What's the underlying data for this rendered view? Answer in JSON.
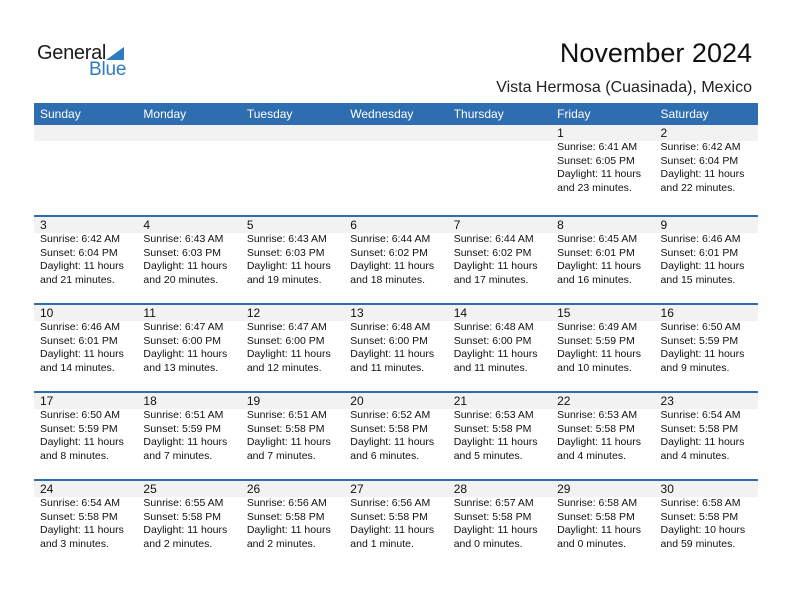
{
  "brand": {
    "name_part1": "General",
    "name_part2": "Blue",
    "accent": "#2e6db0"
  },
  "header": {
    "title": "November 2024",
    "location": "Vista Hermosa (Cuasinada), Mexico"
  },
  "weekdays": [
    "Sunday",
    "Monday",
    "Tuesday",
    "Wednesday",
    "Thursday",
    "Friday",
    "Saturday"
  ],
  "weeks": [
    [
      null,
      null,
      null,
      null,
      null,
      {
        "day": "1",
        "sunrise": "Sunrise: 6:41 AM",
        "sunset": "Sunset: 6:05 PM",
        "daylight1": "Daylight: 11 hours",
        "daylight2": "and 23 minutes."
      },
      {
        "day": "2",
        "sunrise": "Sunrise: 6:42 AM",
        "sunset": "Sunset: 6:04 PM",
        "daylight1": "Daylight: 11 hours",
        "daylight2": "and 22 minutes."
      }
    ],
    [
      {
        "day": "3",
        "sunrise": "Sunrise: 6:42 AM",
        "sunset": "Sunset: 6:04 PM",
        "daylight1": "Daylight: 11 hours",
        "daylight2": "and 21 minutes."
      },
      {
        "day": "4",
        "sunrise": "Sunrise: 6:43 AM",
        "sunset": "Sunset: 6:03 PM",
        "daylight1": "Daylight: 11 hours",
        "daylight2": "and 20 minutes."
      },
      {
        "day": "5",
        "sunrise": "Sunrise: 6:43 AM",
        "sunset": "Sunset: 6:03 PM",
        "daylight1": "Daylight: 11 hours",
        "daylight2": "and 19 minutes."
      },
      {
        "day": "6",
        "sunrise": "Sunrise: 6:44 AM",
        "sunset": "Sunset: 6:02 PM",
        "daylight1": "Daylight: 11 hours",
        "daylight2": "and 18 minutes."
      },
      {
        "day": "7",
        "sunrise": "Sunrise: 6:44 AM",
        "sunset": "Sunset: 6:02 PM",
        "daylight1": "Daylight: 11 hours",
        "daylight2": "and 17 minutes."
      },
      {
        "day": "8",
        "sunrise": "Sunrise: 6:45 AM",
        "sunset": "Sunset: 6:01 PM",
        "daylight1": "Daylight: 11 hours",
        "daylight2": "and 16 minutes."
      },
      {
        "day": "9",
        "sunrise": "Sunrise: 6:46 AM",
        "sunset": "Sunset: 6:01 PM",
        "daylight1": "Daylight: 11 hours",
        "daylight2": "and 15 minutes."
      }
    ],
    [
      {
        "day": "10",
        "sunrise": "Sunrise: 6:46 AM",
        "sunset": "Sunset: 6:01 PM",
        "daylight1": "Daylight: 11 hours",
        "daylight2": "and 14 minutes."
      },
      {
        "day": "11",
        "sunrise": "Sunrise: 6:47 AM",
        "sunset": "Sunset: 6:00 PM",
        "daylight1": "Daylight: 11 hours",
        "daylight2": "and 13 minutes."
      },
      {
        "day": "12",
        "sunrise": "Sunrise: 6:47 AM",
        "sunset": "Sunset: 6:00 PM",
        "daylight1": "Daylight: 11 hours",
        "daylight2": "and 12 minutes."
      },
      {
        "day": "13",
        "sunrise": "Sunrise: 6:48 AM",
        "sunset": "Sunset: 6:00 PM",
        "daylight1": "Daylight: 11 hours",
        "daylight2": "and 11 minutes."
      },
      {
        "day": "14",
        "sunrise": "Sunrise: 6:48 AM",
        "sunset": "Sunset: 6:00 PM",
        "daylight1": "Daylight: 11 hours",
        "daylight2": "and 11 minutes."
      },
      {
        "day": "15",
        "sunrise": "Sunrise: 6:49 AM",
        "sunset": "Sunset: 5:59 PM",
        "daylight1": "Daylight: 11 hours",
        "daylight2": "and 10 minutes."
      },
      {
        "day": "16",
        "sunrise": "Sunrise: 6:50 AM",
        "sunset": "Sunset: 5:59 PM",
        "daylight1": "Daylight: 11 hours",
        "daylight2": "and 9 minutes."
      }
    ],
    [
      {
        "day": "17",
        "sunrise": "Sunrise: 6:50 AM",
        "sunset": "Sunset: 5:59 PM",
        "daylight1": "Daylight: 11 hours",
        "daylight2": "and 8 minutes."
      },
      {
        "day": "18",
        "sunrise": "Sunrise: 6:51 AM",
        "sunset": "Sunset: 5:59 PM",
        "daylight1": "Daylight: 11 hours",
        "daylight2": "and 7 minutes."
      },
      {
        "day": "19",
        "sunrise": "Sunrise: 6:51 AM",
        "sunset": "Sunset: 5:58 PM",
        "daylight1": "Daylight: 11 hours",
        "daylight2": "and 7 minutes."
      },
      {
        "day": "20",
        "sunrise": "Sunrise: 6:52 AM",
        "sunset": "Sunset: 5:58 PM",
        "daylight1": "Daylight: 11 hours",
        "daylight2": "and 6 minutes."
      },
      {
        "day": "21",
        "sunrise": "Sunrise: 6:53 AM",
        "sunset": "Sunset: 5:58 PM",
        "daylight1": "Daylight: 11 hours",
        "daylight2": "and 5 minutes."
      },
      {
        "day": "22",
        "sunrise": "Sunrise: 6:53 AM",
        "sunset": "Sunset: 5:58 PM",
        "daylight1": "Daylight: 11 hours",
        "daylight2": "and 4 minutes."
      },
      {
        "day": "23",
        "sunrise": "Sunrise: 6:54 AM",
        "sunset": "Sunset: 5:58 PM",
        "daylight1": "Daylight: 11 hours",
        "daylight2": "and 4 minutes."
      }
    ],
    [
      {
        "day": "24",
        "sunrise": "Sunrise: 6:54 AM",
        "sunset": "Sunset: 5:58 PM",
        "daylight1": "Daylight: 11 hours",
        "daylight2": "and 3 minutes."
      },
      {
        "day": "25",
        "sunrise": "Sunrise: 6:55 AM",
        "sunset": "Sunset: 5:58 PM",
        "daylight1": "Daylight: 11 hours",
        "daylight2": "and 2 minutes."
      },
      {
        "day": "26",
        "sunrise": "Sunrise: 6:56 AM",
        "sunset": "Sunset: 5:58 PM",
        "daylight1": "Daylight: 11 hours",
        "daylight2": "and 2 minutes."
      },
      {
        "day": "27",
        "sunrise": "Sunrise: 6:56 AM",
        "sunset": "Sunset: 5:58 PM",
        "daylight1": "Daylight: 11 hours",
        "daylight2": "and 1 minute."
      },
      {
        "day": "28",
        "sunrise": "Sunrise: 6:57 AM",
        "sunset": "Sunset: 5:58 PM",
        "daylight1": "Daylight: 11 hours",
        "daylight2": "and 0 minutes."
      },
      {
        "day": "29",
        "sunrise": "Sunrise: 6:58 AM",
        "sunset": "Sunset: 5:58 PM",
        "daylight1": "Daylight: 11 hours",
        "daylight2": "and 0 minutes."
      },
      {
        "day": "30",
        "sunrise": "Sunrise: 6:58 AM",
        "sunset": "Sunset: 5:58 PM",
        "daylight1": "Daylight: 10 hours",
        "daylight2": "and 59 minutes."
      }
    ]
  ]
}
